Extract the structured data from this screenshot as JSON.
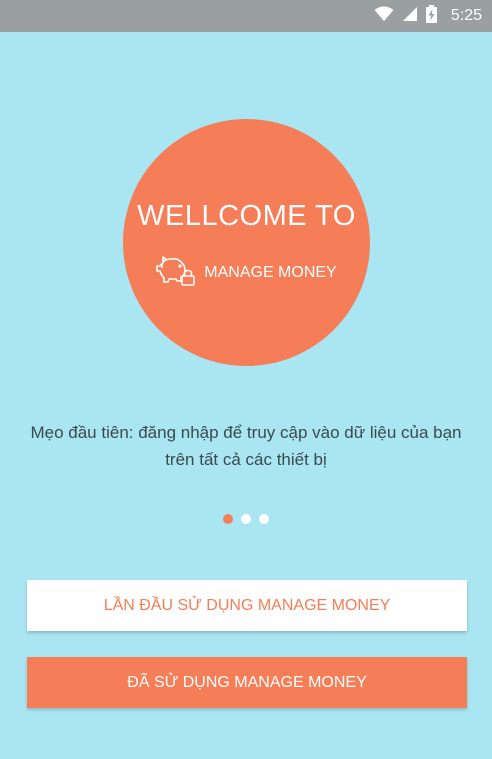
{
  "status_bar": {
    "time": "5:25",
    "icons": [
      "wifi-icon",
      "signal-icon",
      "battery-charging-icon"
    ]
  },
  "hero": {
    "title": "WELLCOME TO",
    "app_name": "MANAGE MONEY",
    "icon": "piggy-bank-lock-icon"
  },
  "tip": {
    "text": "Mẹo đầu tiên: đăng nhập để truy cập vào dữ liệu của bạn trên tất cả các thiết bị"
  },
  "pager": {
    "count": 3,
    "active_index": 0
  },
  "buttons": {
    "first_time": "LẦN ĐẦU SỬ DỤNG MANAGE MONEY",
    "already_used": "ĐÃ SỬ DỤNG MANAGE MONEY"
  },
  "colors": {
    "background": "#a9e6f1",
    "accent": "#f57d57",
    "status_bar": "#9aa0a2"
  }
}
